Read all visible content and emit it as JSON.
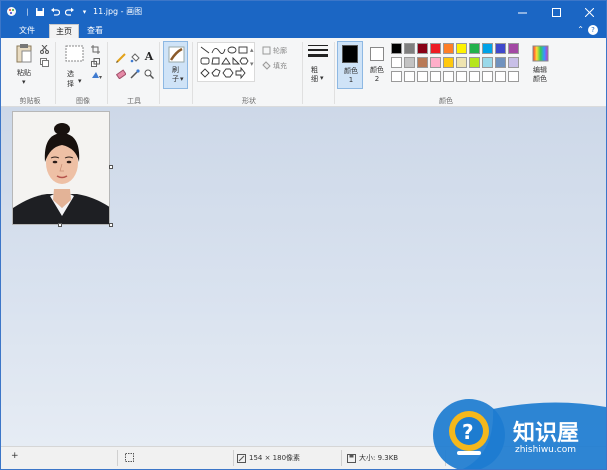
{
  "window": {
    "title": "11.jpg - 画图",
    "minimize_icon": "minimize-icon",
    "maximize_icon": "maximize-icon",
    "close_icon": "close-icon"
  },
  "quick_access": {
    "icons": [
      "paint-app-icon",
      "save-icon",
      "undo-icon",
      "redo-icon",
      "customize-icon"
    ]
  },
  "tabs": [
    {
      "label": "文件",
      "active": false
    },
    {
      "label": "主页",
      "active": true
    },
    {
      "label": "查看",
      "active": false
    }
  ],
  "ribbon": {
    "clipboard": {
      "paste_label": "粘贴",
      "group_label": "剪贴板"
    },
    "image": {
      "select_label": "选择",
      "group_label": "图像"
    },
    "tools": {
      "group_label": "工具",
      "text_tool": "A"
    },
    "brushes": {
      "label": "刷子"
    },
    "shapes": {
      "outline_label": "轮廓",
      "fill_label": "填充",
      "group_label": "形状"
    },
    "size": {
      "label": "粗细"
    },
    "color1": {
      "label": "颜色 1",
      "value": "#000000"
    },
    "color2": {
      "label": "颜色 2",
      "value": "#ffffff"
    },
    "colors": {
      "group_label": "颜色",
      "edit_label": "编辑颜色",
      "palette_row1": [
        "#000000",
        "#7f7f7f",
        "#880015",
        "#ed1c24",
        "#ff7f27",
        "#fff200",
        "#22b14c",
        "#00a2e8",
        "#3f48cc",
        "#a349a4"
      ],
      "palette_row2": [
        "#ffffff",
        "#c3c3c3",
        "#b97a57",
        "#ffaec9",
        "#ffc90e",
        "#efe4b0",
        "#b5e61d",
        "#99d9ea",
        "#7092be",
        "#c8bfe7"
      ],
      "palette_row3": [
        "#ffffff",
        "#ffffff",
        "#ffffff",
        "#ffffff",
        "#ffffff",
        "#ffffff",
        "#ffffff",
        "#ffffff",
        "#ffffff",
        "#ffffff"
      ]
    }
  },
  "status": {
    "dimensions": "154 × 180像素",
    "size": "大小: 9.3KB"
  },
  "watermark": {
    "text": "知识屋",
    "url": "zhishiwu.com"
  }
}
